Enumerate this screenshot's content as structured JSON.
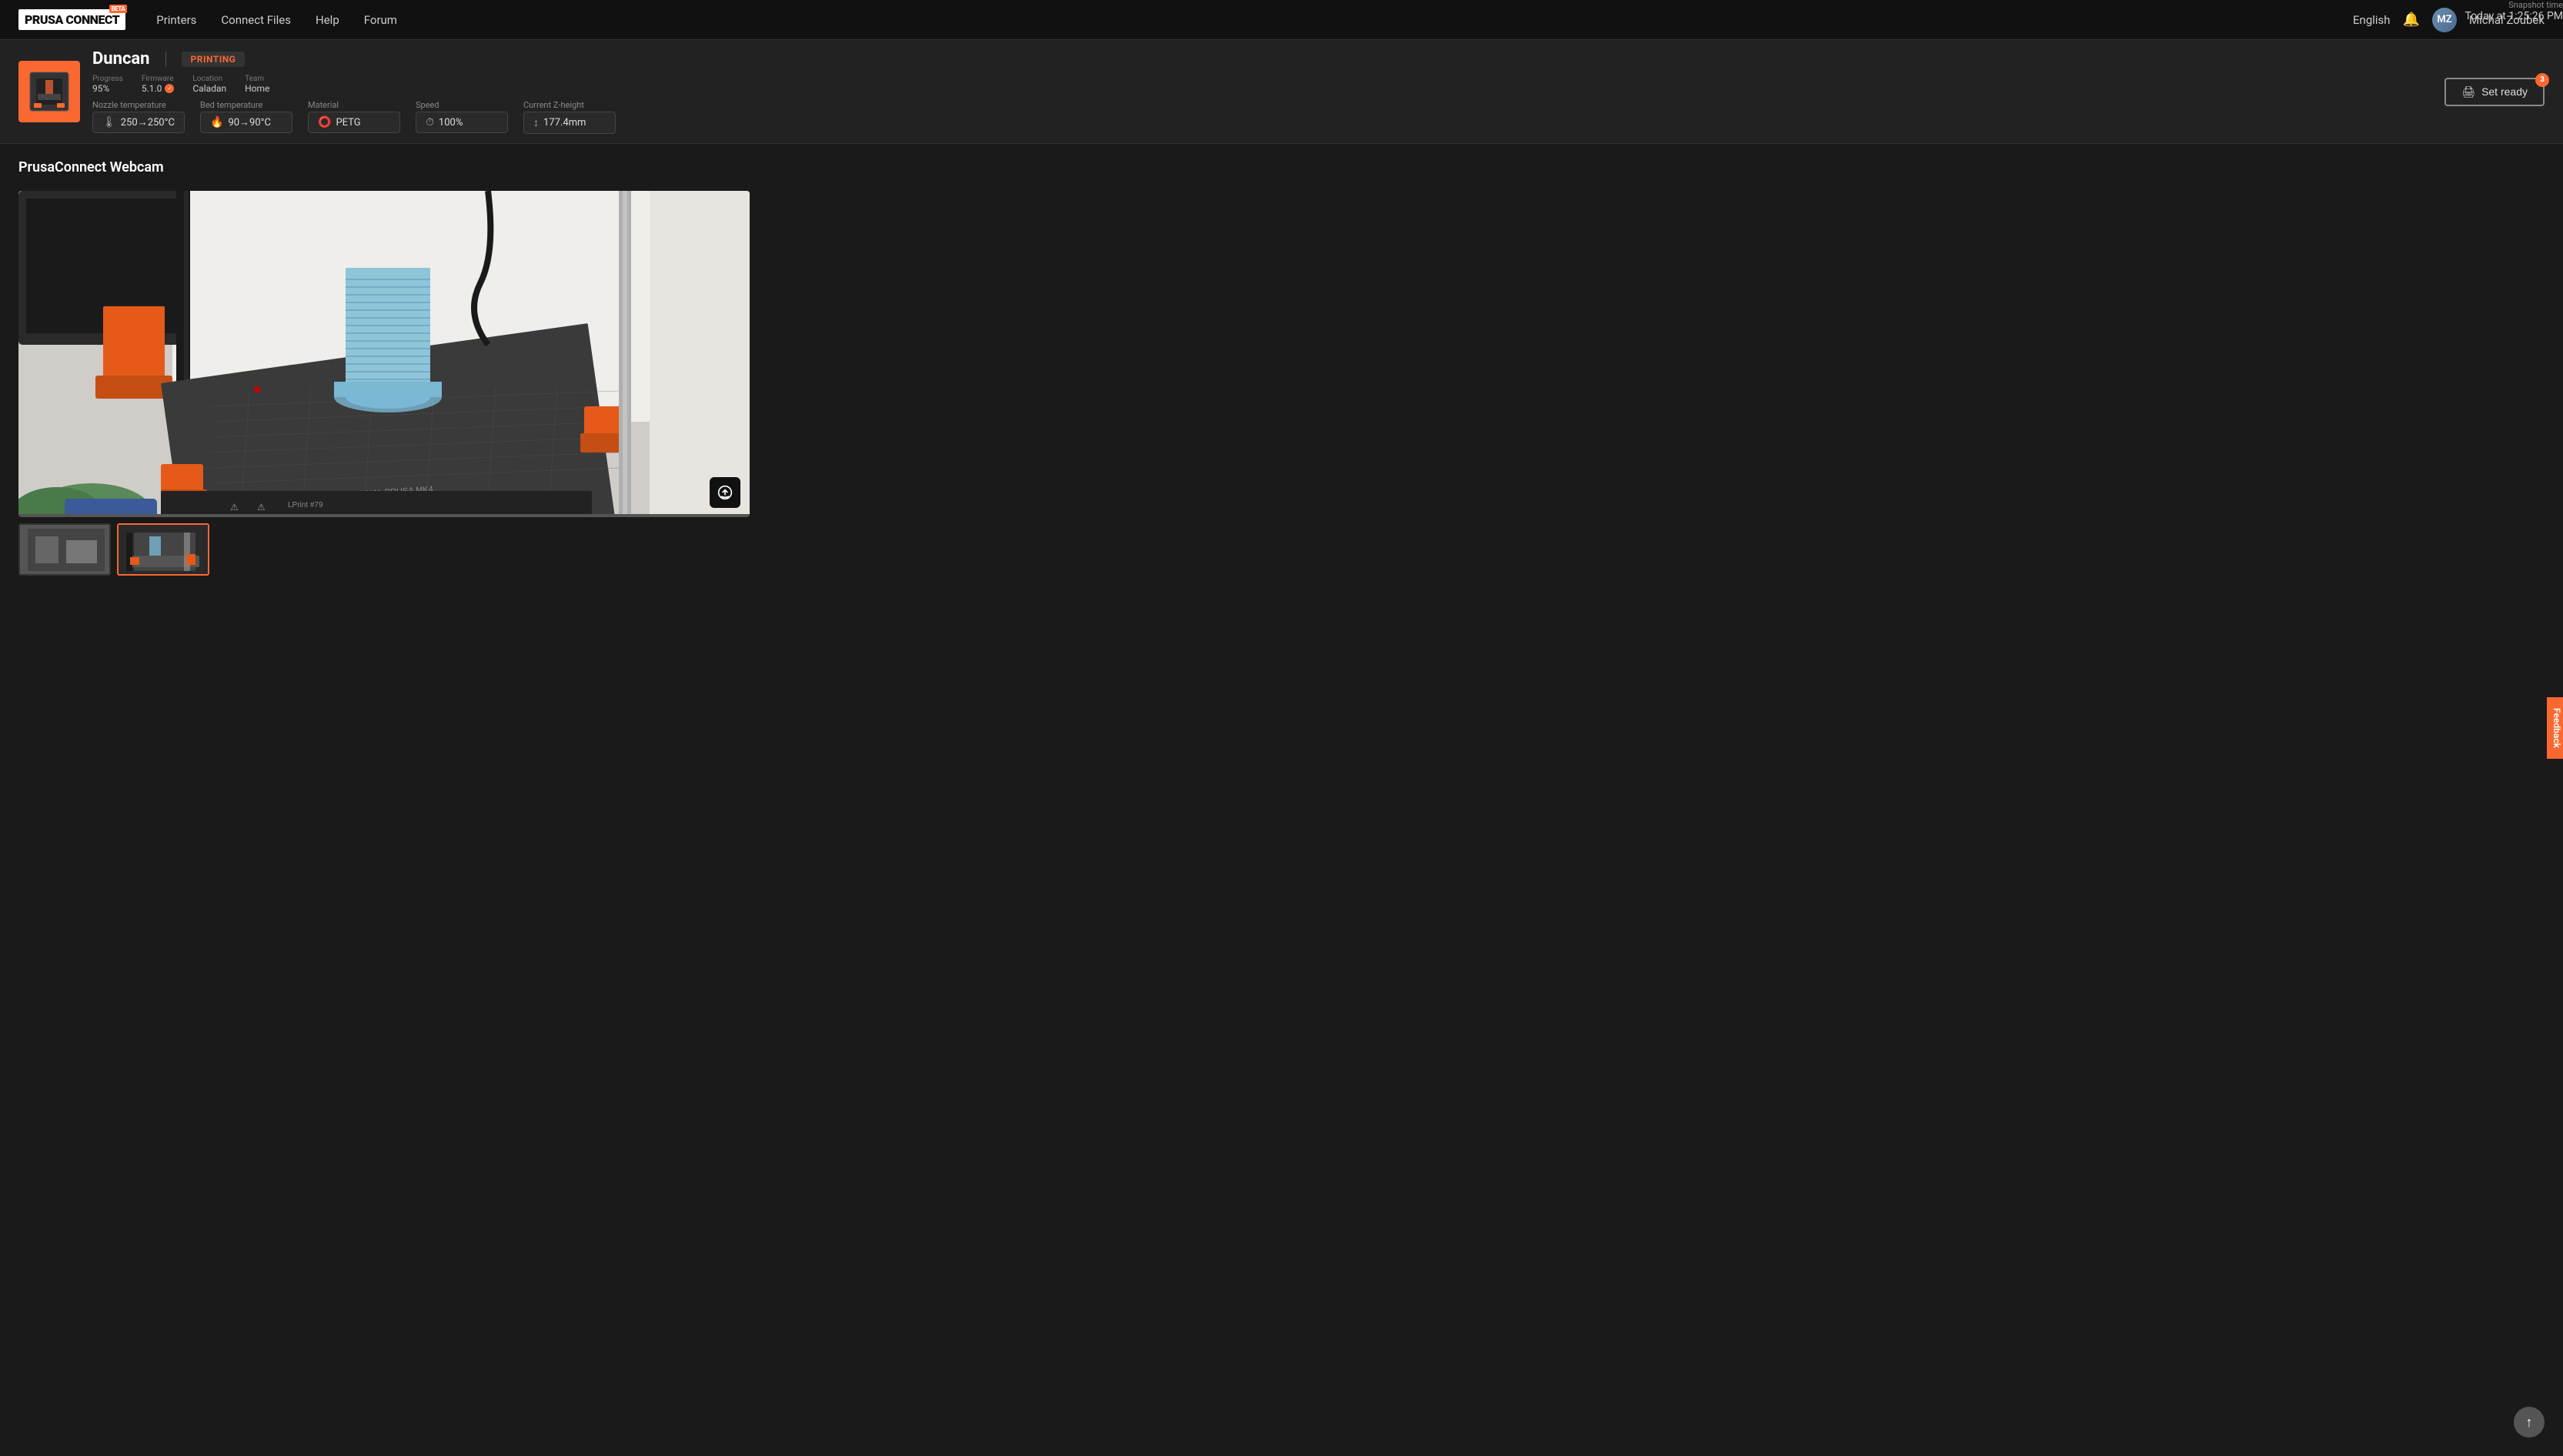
{
  "navbar": {
    "logo_text": "PRUSA CONNECT",
    "beta_label": "BETA",
    "links": [
      {
        "label": "Printers",
        "href": "#"
      },
      {
        "label": "Connect Files",
        "href": "#"
      },
      {
        "label": "Help",
        "href": "#"
      },
      {
        "label": "Forum",
        "href": "#"
      }
    ],
    "language": "English",
    "username": "Michal Zoubek"
  },
  "printer": {
    "name": "Duncan",
    "status": "PRINTING",
    "progress_label": "Progress",
    "progress_value": "95%",
    "firmware_label": "Firmware",
    "firmware_value": "5.1.0",
    "location_label": "Location",
    "location_value": "Caladan",
    "team_label": "Team",
    "team_value": "Home",
    "nozzle_label": "Nozzle temperature",
    "nozzle_value": "250→250°C",
    "bed_label": "Bed temperature",
    "bed_value": "90→90°C",
    "material_label": "Material",
    "material_value": "PETG",
    "speed_label": "Speed",
    "speed_value": "100%",
    "z_height_label": "Current Z-height",
    "z_height_value": "177.4mm",
    "set_ready_label": "Set ready",
    "set_ready_badge": "3"
  },
  "webcam": {
    "title": "PrusaConnect Webcam",
    "snapshot_label": "Snapshot time",
    "snapshot_time": "Today at 1:25:26 PM"
  },
  "feedback": {
    "label": "Feedback"
  },
  "scroll_top": "↑"
}
